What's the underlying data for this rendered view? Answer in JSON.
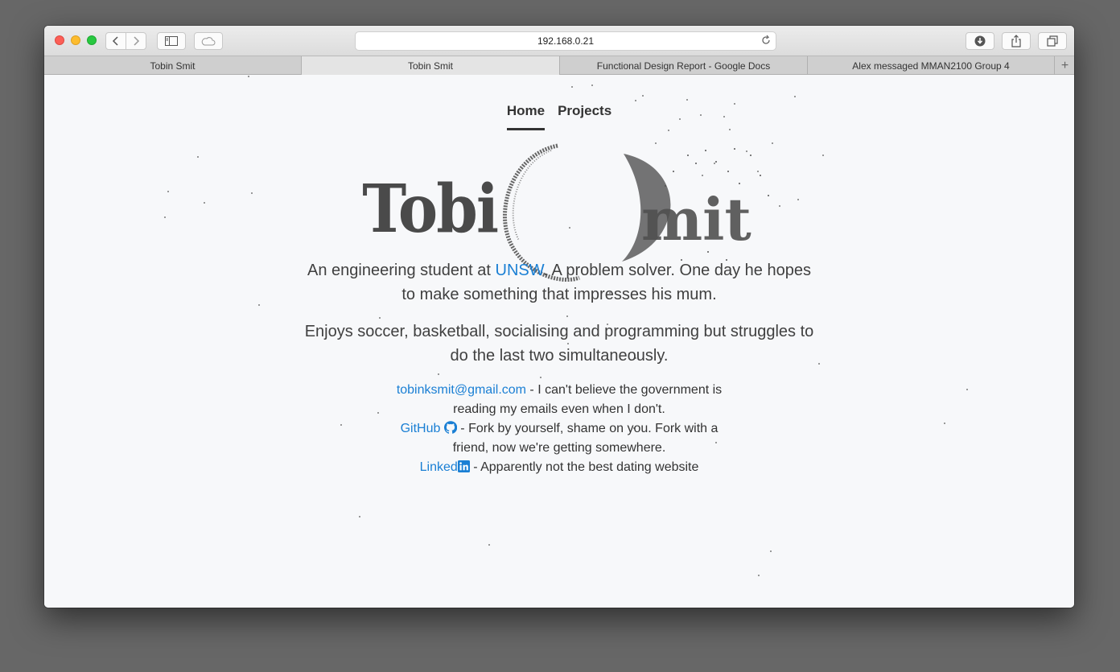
{
  "browser": {
    "address": "192.168.0.21",
    "tabs": [
      {
        "label": "Tobin Smit",
        "active": false
      },
      {
        "label": "Tobin Smit",
        "active": true
      },
      {
        "label": "Functional Design Report - Google Docs",
        "active": false
      },
      {
        "label": "Alex messaged MMAN2100 Group 4",
        "active": false
      }
    ],
    "new_tab": "+"
  },
  "nav": {
    "home": "Home",
    "projects": "Projects"
  },
  "logo": {
    "left": "Tobi",
    "right": "mit"
  },
  "intro": {
    "p1_before": "An engineering student at ",
    "p1_link": "UNSW",
    "p1_after": ". A problem solver. One day he hopes to make something that impresses his mum.",
    "p2": "Enjoys soccer, basketball, socialising and programming but struggles to do the last two simultaneously."
  },
  "contacts": {
    "email_link": "tobinksmit@gmail.com",
    "email_text": " - I can't believe the government is reading my emails even when I don't.",
    "github_link": "GitHub",
    "github_text": " - Fork by yourself, shame on you. Fork with a friend, now we're getting somewhere.",
    "linkedin_link": "Linked",
    "linkedin_text": " - Apparently not the best dating website"
  },
  "colors": {
    "link": "#1a7fd4",
    "text": "#333333",
    "logo": "#4a4a4a"
  }
}
